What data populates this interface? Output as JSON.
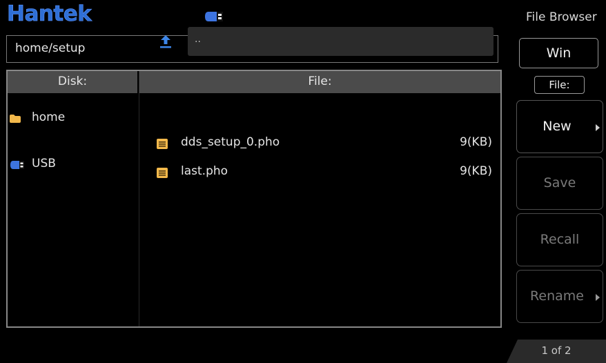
{
  "header": {
    "logo": "Hantek",
    "usb_status_icon": "usb-drive-icon"
  },
  "path": {
    "value": "home/setup"
  },
  "panel": {
    "disk_header": "Disk:",
    "file_header": "File:",
    "disks": [
      {
        "label": "home",
        "icon": "folder-icon",
        "color": "#f2b84b"
      },
      {
        "label": "USB",
        "icon": "usb-drive-icon",
        "color": "#3d74e0"
      }
    ],
    "parent_dir": "..",
    "files": [
      {
        "name": "dds_setup_0.pho",
        "size": "9(KB)",
        "icon": "file-icon"
      },
      {
        "name": "last.pho",
        "size": "9(KB)",
        "icon": "file-icon"
      }
    ]
  },
  "sidebar": {
    "title": "File Browser",
    "view_button": "Win",
    "type_selector": "File:",
    "buttons": [
      {
        "label": "New",
        "enabled": true,
        "has_submenu": true
      },
      {
        "label": "Save",
        "enabled": false,
        "has_submenu": false
      },
      {
        "label": "Recall",
        "enabled": false,
        "has_submenu": false
      },
      {
        "label": "Rename",
        "enabled": false,
        "has_submenu": true
      }
    ],
    "page_indicator": "1 of 2"
  },
  "colors": {
    "brand_blue": "#2f6fd6",
    "folder": "#f2b84b",
    "header_bg": "#4b4b4b",
    "upload_icon": "#3d86e8"
  }
}
